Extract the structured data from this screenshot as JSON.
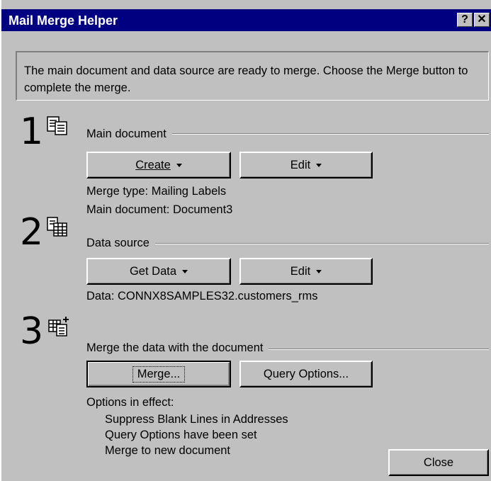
{
  "window": {
    "title": "Mail Merge Helper",
    "help_button": "?",
    "close_button": "✕"
  },
  "info": {
    "text": "The main document and data source are ready to merge. Choose the Merge button to complete the merge."
  },
  "step1": {
    "number": "1",
    "label": "Main document",
    "create_button": "Create",
    "edit_button": "Edit",
    "merge_type": "Merge type: Mailing Labels",
    "main_document": "Main document: Document3"
  },
  "step2": {
    "number": "2",
    "label": "Data source",
    "get_data_button": "Get Data",
    "edit_button": "Edit",
    "data": "Data: CONNX8SAMPLES32.customers_rms"
  },
  "step3": {
    "number": "3",
    "label": "Merge the data with the document",
    "merge_button": "Merge...",
    "query_options_button": "Query Options...",
    "options_header": "Options in effect:",
    "options": [
      "Suppress Blank Lines in Addresses",
      "Query Options have been set",
      "Merge to new document"
    ]
  },
  "footer": {
    "close_button": "Close"
  }
}
